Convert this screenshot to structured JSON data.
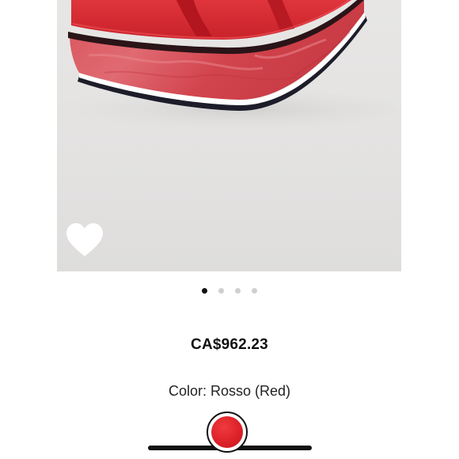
{
  "product": {
    "image_alt": "Red platform wedge sandal",
    "price": "CA$962.23",
    "color_label": "Color:",
    "color_value": "Rosso (Red)",
    "selected_swatch_color": "#dd2229"
  },
  "gallery": {
    "total_images": 4,
    "active_index": 0
  },
  "icons": {
    "wishlist": "heart-icon"
  },
  "colors": {
    "accent": "#dd2229",
    "text": "#111111",
    "dot_inactive": "#cfcfcf"
  }
}
